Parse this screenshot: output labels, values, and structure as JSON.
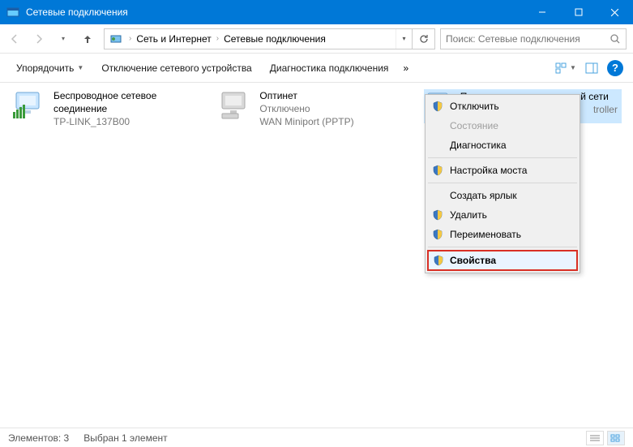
{
  "window": {
    "title": "Сетевые подключения"
  },
  "breadcrumb": {
    "level1": "Сеть и Интернет",
    "level2": "Сетевые подключения"
  },
  "search": {
    "placeholder": "Поиск: Сетевые подключения"
  },
  "toolbar": {
    "organize": "Упорядочить",
    "disable": "Отключение сетевого устройства",
    "diagnose": "Диагностика подключения"
  },
  "connections": [
    {
      "name": "Беспроводное сетевое соединение",
      "status": "TP-LINK_137B00"
    },
    {
      "name": "Оптинет",
      "status": "Отключено",
      "detail": "WAN Miniport (PPTP)"
    },
    {
      "name": "Подключение по локальной сети",
      "status": "",
      "detail": "troller"
    }
  ],
  "contextmenu": {
    "disable": "Отключить",
    "state": "Состояние",
    "diag": "Диагностика",
    "bridge": "Настройка моста",
    "shortcut": "Создать ярлык",
    "delete": "Удалить",
    "rename": "Переименовать",
    "properties": "Свойства"
  },
  "statusbar": {
    "count": "Элементов: 3",
    "selection": "Выбран 1 элемент"
  }
}
